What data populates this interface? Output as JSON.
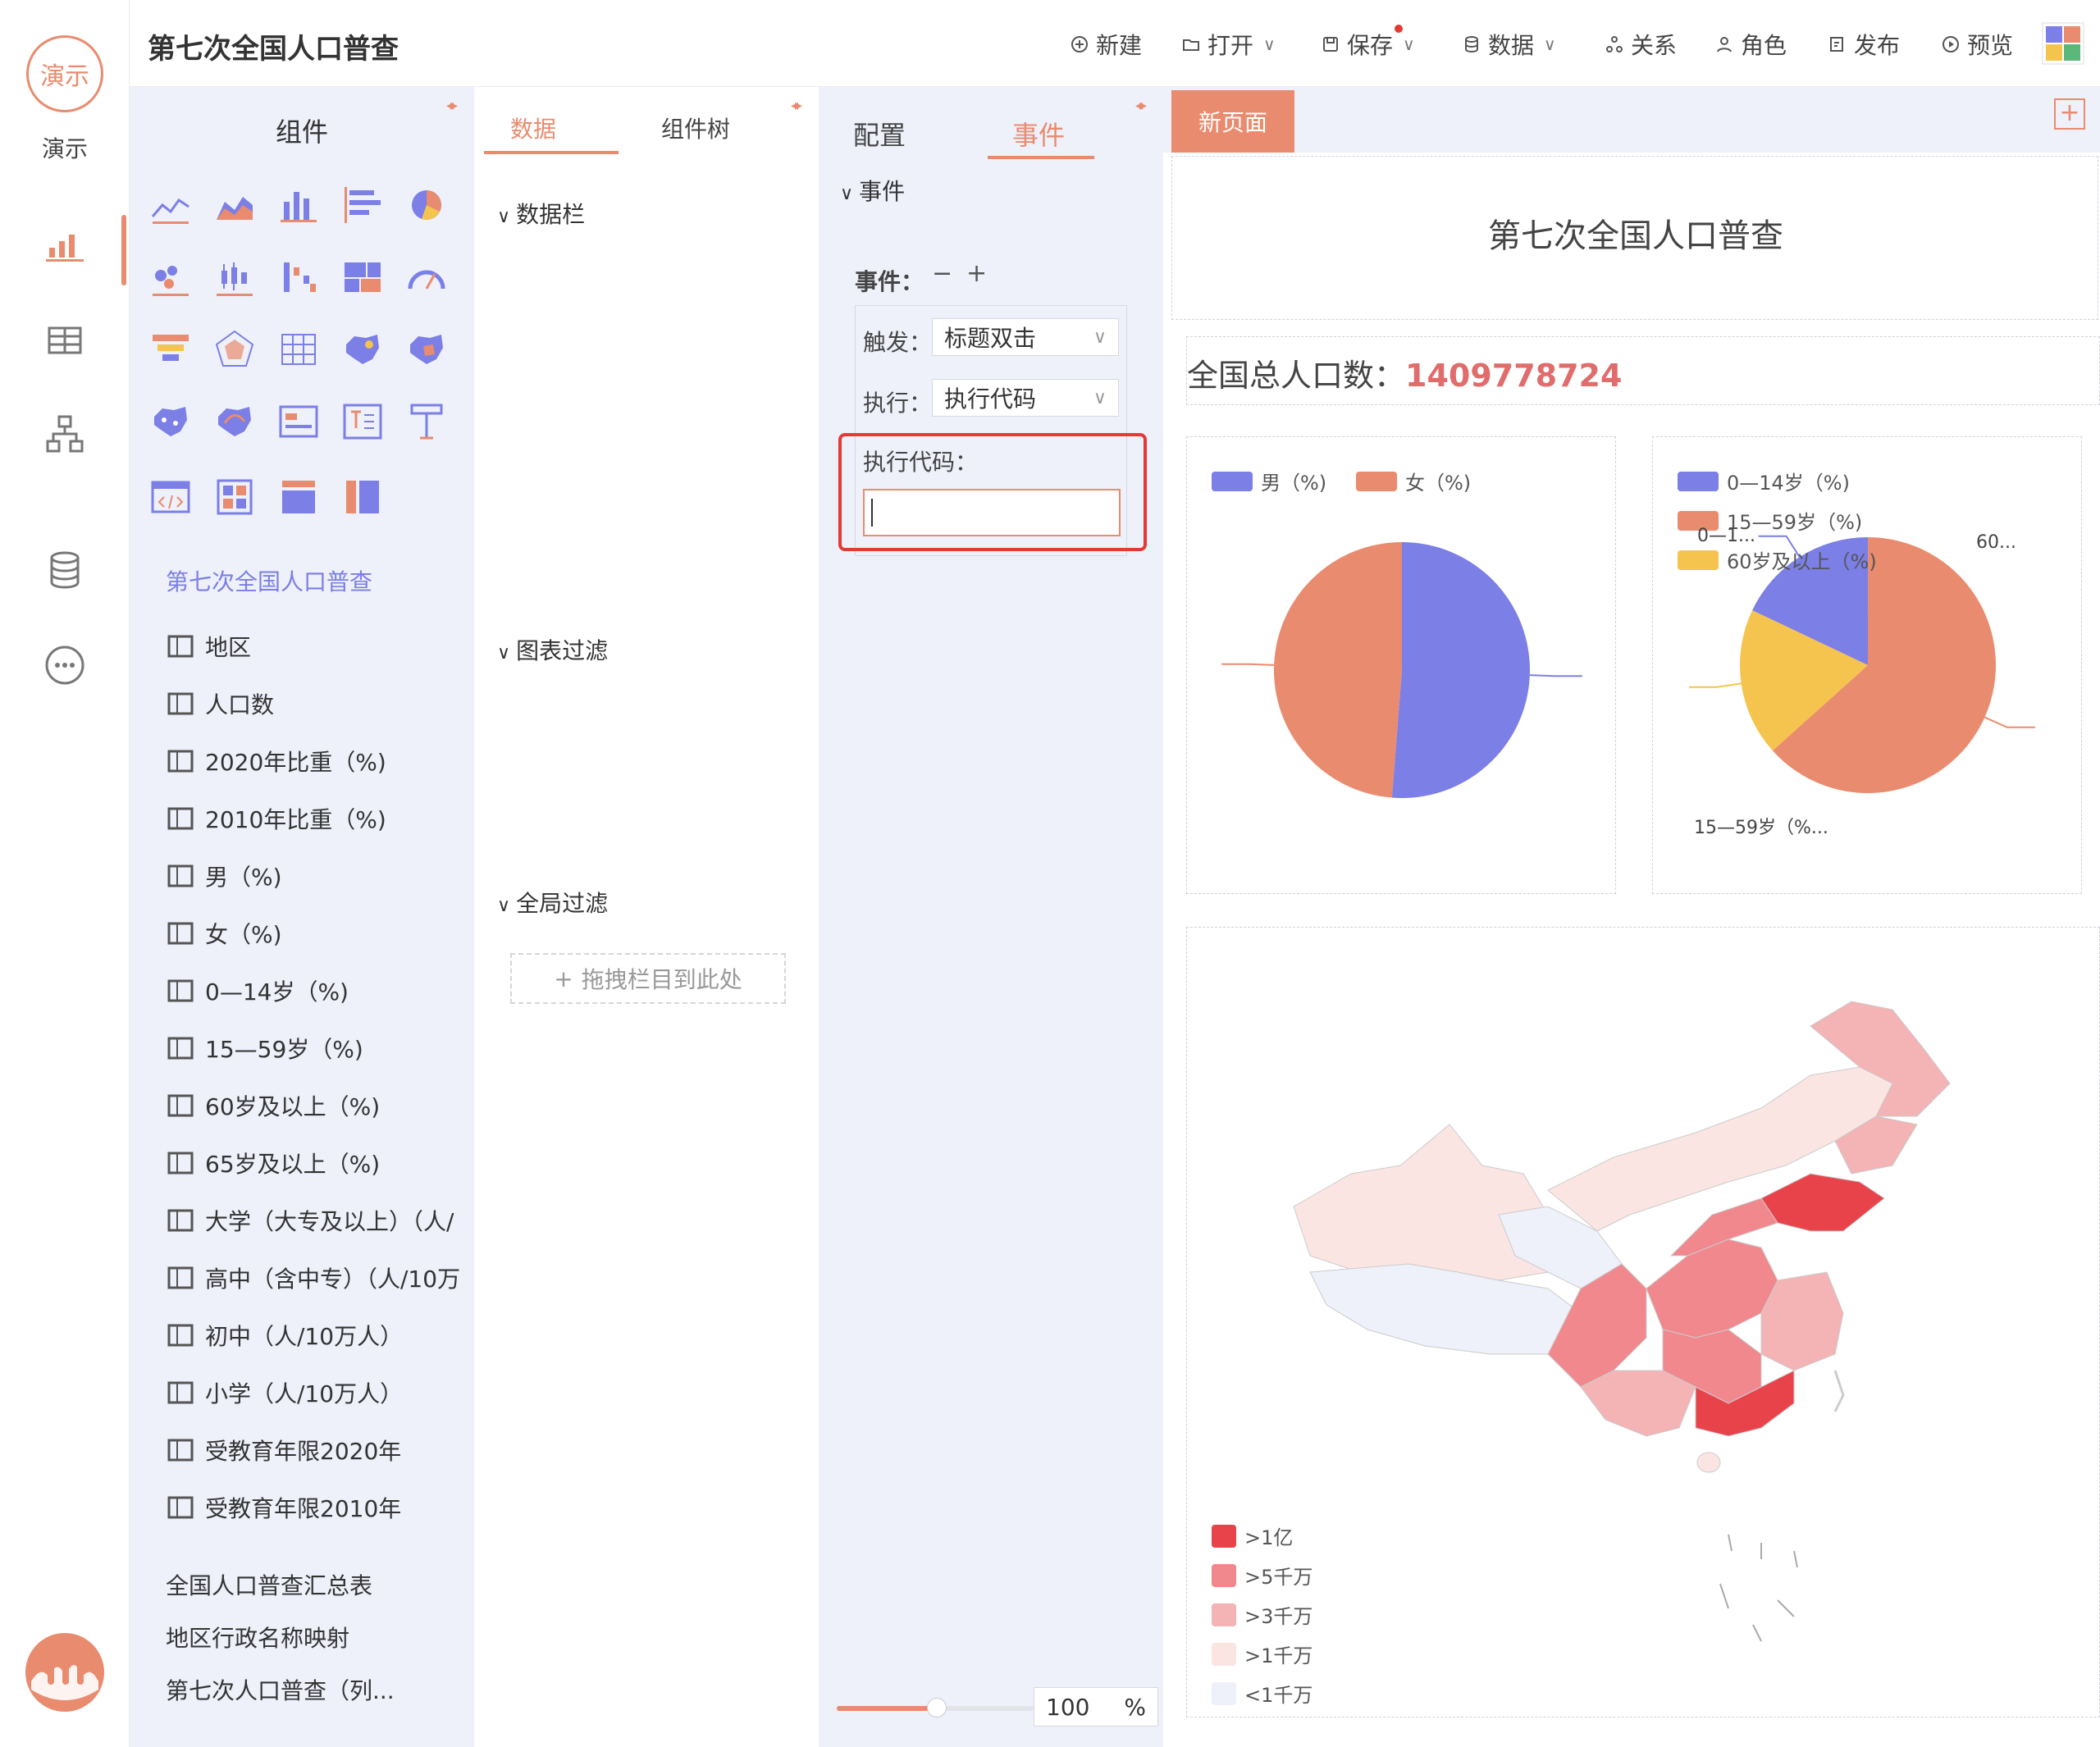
{
  "sidebar": {
    "logo_text": "演示",
    "app_name": "演示"
  },
  "topbar": {
    "title": "第七次全国人口普查",
    "new": "新建",
    "open": "打开",
    "save": "保存",
    "data": "数据",
    "relation": "关系",
    "role": "角色",
    "publish": "发布",
    "preview": "预览"
  },
  "components": {
    "title": "组件",
    "root": "第七次全国人口普查",
    "fields": [
      "地区",
      "人口数",
      "2020年比重（%)",
      "2010年比重（%)",
      "男（%)",
      "女（%)",
      "0—14岁（%)",
      "15—59岁（%)",
      "60岁及以上（%)",
      "65岁及以上（%)",
      "大学（大专及以上）（人/",
      "高中（含中专）（人/10万",
      "初中（人/10万人）",
      "小学（人/10万人）",
      "受教育年限2020年",
      "受教育年限2010年"
    ],
    "tables": [
      "全国人口普查汇总表",
      "地区行政名称映射",
      "第七次人口普查（列..."
    ]
  },
  "data_panel": {
    "tab_data": "数据",
    "tab_tree": "组件树",
    "data_bar": "数据栏",
    "chart_filter": "图表过滤",
    "global_filter": "全局过滤",
    "drop_hint": "拖拽栏目到此处"
  },
  "config_panel": {
    "tab_config": "配置",
    "tab_event": "事件",
    "section": "事件",
    "events_label": "事件：",
    "trigger_label": "触发：",
    "trigger_value": "标题双击",
    "execute_label": "执行：",
    "execute_value": "执行代码",
    "code_label": "执行代码：",
    "code_value": "",
    "zoom_value": "100",
    "zoom_unit": "%"
  },
  "canvas": {
    "page_tab": "新页面",
    "title": "第七次全国人口普查",
    "total_label": "全国总人口数：",
    "total_value": "1409778724"
  },
  "colors": {
    "accent": "#e98b6e",
    "purple": "#7b7fe6",
    "yellow": "#f5c44e",
    "highlight": "#e53935"
  },
  "chart_data": [
    {
      "type": "pie",
      "legend": [
        "男（%)",
        "女（%)"
      ],
      "values": [
        51.24,
        48.76
      ],
      "colors": [
        "#7b7fe6",
        "#e98b6e"
      ]
    },
    {
      "type": "pie",
      "legend": [
        "0—14岁（%)",
        "15—59岁（%)",
        "60岁及以上（%)"
      ],
      "values": [
        17.95,
        63.35,
        18.7
      ],
      "colors": [
        "#7b7fe6",
        "#e98b6e",
        "#f5c44e"
      ],
      "labels": [
        "0—1...",
        "15—59岁（%...",
        "60..."
      ]
    },
    {
      "type": "map",
      "legend": [
        ">1亿",
        ">5千万",
        ">3千万",
        ">1千万",
        "<1千万"
      ],
      "colors": [
        "#e8434a",
        "#f0888d",
        "#f4b3b5",
        "#fbe5e2",
        "#eef0fa"
      ]
    }
  ]
}
